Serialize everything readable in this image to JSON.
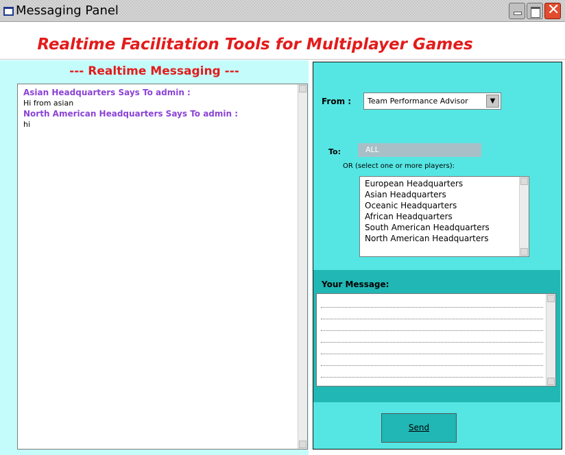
{
  "window": {
    "title": "Messaging Panel"
  },
  "heading": "Realtime Facilitation Tools for Multiplayer Games",
  "left": {
    "title": "--- Realtime Messaging ---",
    "messages": [
      {
        "header": "Asian Headquarters Says To admin :",
        "body": "Hi from asian"
      },
      {
        "header": "North American Headquarters Says To admin :",
        "body": "hi"
      }
    ]
  },
  "right": {
    "from_label": "From :",
    "from_value": "Team Performance Advisor",
    "to_label": "To:",
    "to_value": "ALL",
    "or_text": "OR (select one or more players):",
    "players": [
      "European Headquarters",
      "Asian Headquarters",
      "Oceanic Headquarters",
      "African Headquarters",
      "South American Headquarters",
      "North American Headquarters"
    ],
    "message_label": "Your Message:",
    "send_label": "Send"
  },
  "colors": {
    "heading": "#e31b1b",
    "left_bg": "#c4fcfb",
    "right_bg": "#55e6e3",
    "message_section_bg": "#20b7b4",
    "message_header": "#8b43d6"
  }
}
